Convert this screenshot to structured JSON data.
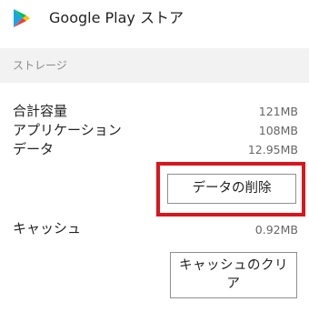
{
  "header": {
    "title": "Google Play ストア",
    "icon": "google-play-icon"
  },
  "section": {
    "title": "ストレージ"
  },
  "storage": {
    "rows": [
      {
        "label": "合計容量",
        "value": "121MB"
      },
      {
        "label": "アプリケーション",
        "value": "108MB"
      },
      {
        "label": "データ",
        "value": "12.95MB"
      }
    ],
    "clear_data_label": "データの削除"
  },
  "cache": {
    "label": "キャッシュ",
    "value": "0.92MB",
    "clear_cache_label": "キャッシュのクリア"
  },
  "colors": {
    "highlight": "#d9161d",
    "play_green": "#00c25a",
    "play_blue": "#1aa6e6",
    "play_red": "#f23b3b",
    "play_yellow": "#ffc107"
  }
}
